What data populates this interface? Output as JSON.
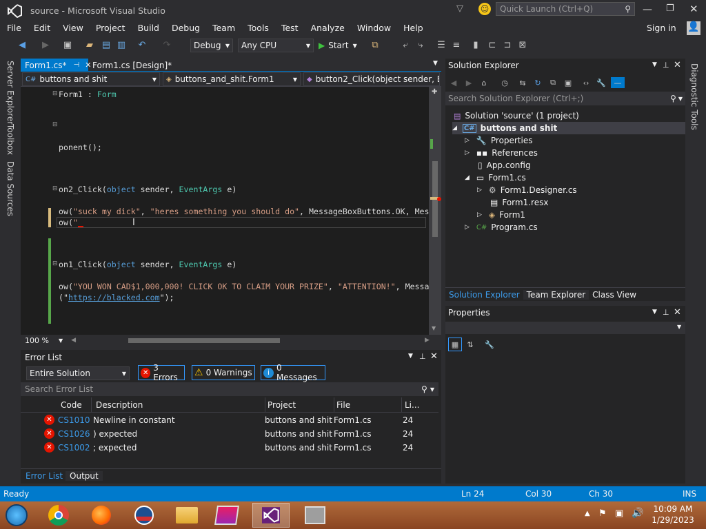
{
  "window": {
    "title": "source - Microsoft Visual Studio",
    "quick_launch_placeholder": "Quick Launch (Ctrl+Q)",
    "sign_in": "Sign in"
  },
  "menu": [
    "File",
    "Edit",
    "View",
    "Project",
    "Build",
    "Debug",
    "Team",
    "Tools",
    "Test",
    "Analyze",
    "Window",
    "Help"
  ],
  "toolbar": {
    "config": "Debug",
    "platform": "Any CPU",
    "start": "Start"
  },
  "left_side_tabs": [
    "Server Explorer",
    "Toolbox",
    "Data Sources"
  ],
  "right_side_tabs": [
    "Diagnostic Tools"
  ],
  "doc_tabs": [
    {
      "label": "Form1.cs*"
    },
    {
      "label": "Form1.cs [Design]*"
    }
  ],
  "nav": {
    "project": "buttons and shit",
    "class": "buttons_and_shit.Form1",
    "member": "button2_Click(object sender, E"
  },
  "editor": {
    "zoom": "100 %",
    "lines": {
      "l1a": "Form1 : ",
      "l1b": "Form",
      "l2": "ponent();",
      "l3a": "on2_Click(",
      "l3b": "object",
      "l3c": " sender, ",
      "l3d": "EventArgs",
      "l3e": " e)",
      "l4a": "ow(",
      "l4b": "\"suck my dick\"",
      "l4c": ", ",
      "l4d": "\"heres something you should do\"",
      "l4e": ", MessageBoxButtons.OK, Mes",
      "l5a": "ow(",
      "l5b": "\"",
      "l6a": "on1_Click(",
      "l6b": "object",
      "l6c": " sender, ",
      "l6d": "EventArgs",
      "l6e": " e)",
      "l7a": "ow(",
      "l7b": "\"YOU WON CAD$1,000,000! CLICK OK TO CLAIM YOUR PRIZE\"",
      "l7c": ", ",
      "l7d": "\"ATTENTION!\"",
      "l7e": ", Messa",
      "l8a": "(\"",
      "l8b": "https://blacked.com",
      "l8c": "\");"
    }
  },
  "solution_explorer": {
    "title": "Solution Explorer",
    "search_placeholder": "Search Solution Explorer (Ctrl+;)",
    "items": [
      {
        "label": "Solution 'source' (1 project)"
      },
      {
        "label": "buttons and shit"
      },
      {
        "label": "Properties"
      },
      {
        "label": "References"
      },
      {
        "label": "App.config"
      },
      {
        "label": "Form1.cs"
      },
      {
        "label": "Form1.Designer.cs"
      },
      {
        "label": "Form1.resx"
      },
      {
        "label": "Form1"
      },
      {
        "label": "Program.cs"
      }
    ],
    "bottom_tabs": [
      "Solution Explorer",
      "Team Explorer",
      "Class View"
    ]
  },
  "properties": {
    "title": "Properties"
  },
  "error_list": {
    "title": "Error List",
    "scope": "Entire Solution",
    "errors_btn": "3 Errors",
    "warnings_btn": "0 Warnings",
    "messages_btn": "0 Messages",
    "search_placeholder": "Search Error List",
    "columns": [
      "Code",
      "Description",
      "Project",
      "File",
      "Li..."
    ],
    "rows": [
      {
        "code": "CS1010",
        "desc": "Newline in constant",
        "project": "buttons and shit",
        "file": "Form1.cs",
        "line": "24"
      },
      {
        "code": "CS1026",
        "desc": ") expected",
        "project": "buttons and shit",
        "file": "Form1.cs",
        "line": "24"
      },
      {
        "code": "CS1002",
        "desc": "; expected",
        "project": "buttons and shit",
        "file": "Form1.cs",
        "line": "24"
      }
    ],
    "bottom_tabs": [
      "Error List",
      "Output"
    ]
  },
  "status": {
    "ready": "Ready",
    "ln": "Ln 24",
    "col": "Col 30",
    "ch": "Ch 30",
    "mode": "INS"
  },
  "taskbar": {
    "time": "10:09 AM",
    "date": "1/29/2023"
  },
  "colors": {
    "accent": "#007acc",
    "error": "#e51400",
    "warning": "#ffcc00"
  }
}
